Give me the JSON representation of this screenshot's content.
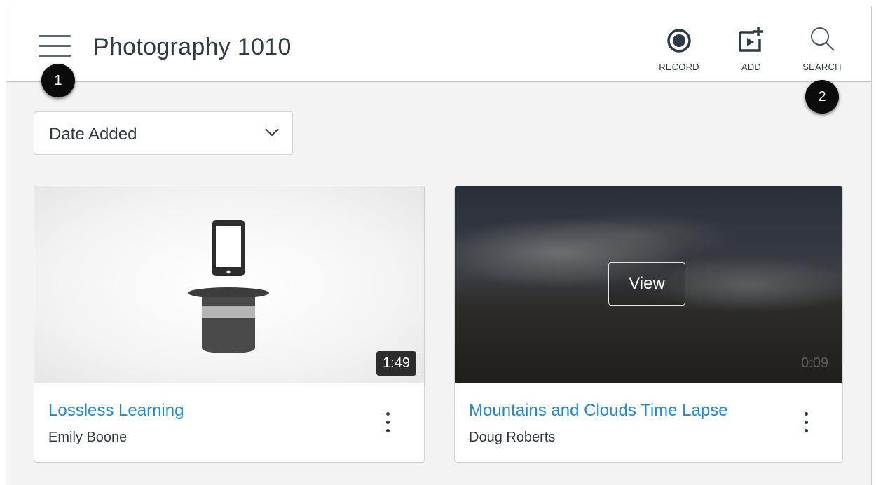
{
  "header": {
    "title": "Photography 1010",
    "actions": [
      {
        "label": "RECORD",
        "icon": "record-icon"
      },
      {
        "label": "ADD",
        "icon": "add-media-icon"
      },
      {
        "label": "SEARCH",
        "icon": "search-icon"
      }
    ]
  },
  "steps": [
    "1",
    "2"
  ],
  "sort": {
    "selected": "Date Added"
  },
  "videos": [
    {
      "title": "Lossless Learning",
      "author": "Emily Boone",
      "duration": "1:49"
    },
    {
      "title": "Mountains and Clouds Time Lapse",
      "author": "Doug Roberts",
      "duration": "0:09",
      "hover_button": "View"
    }
  ],
  "colors": {
    "link": "#1c8ad6",
    "text": "#2d3b45",
    "background": "#f3f3f3"
  }
}
